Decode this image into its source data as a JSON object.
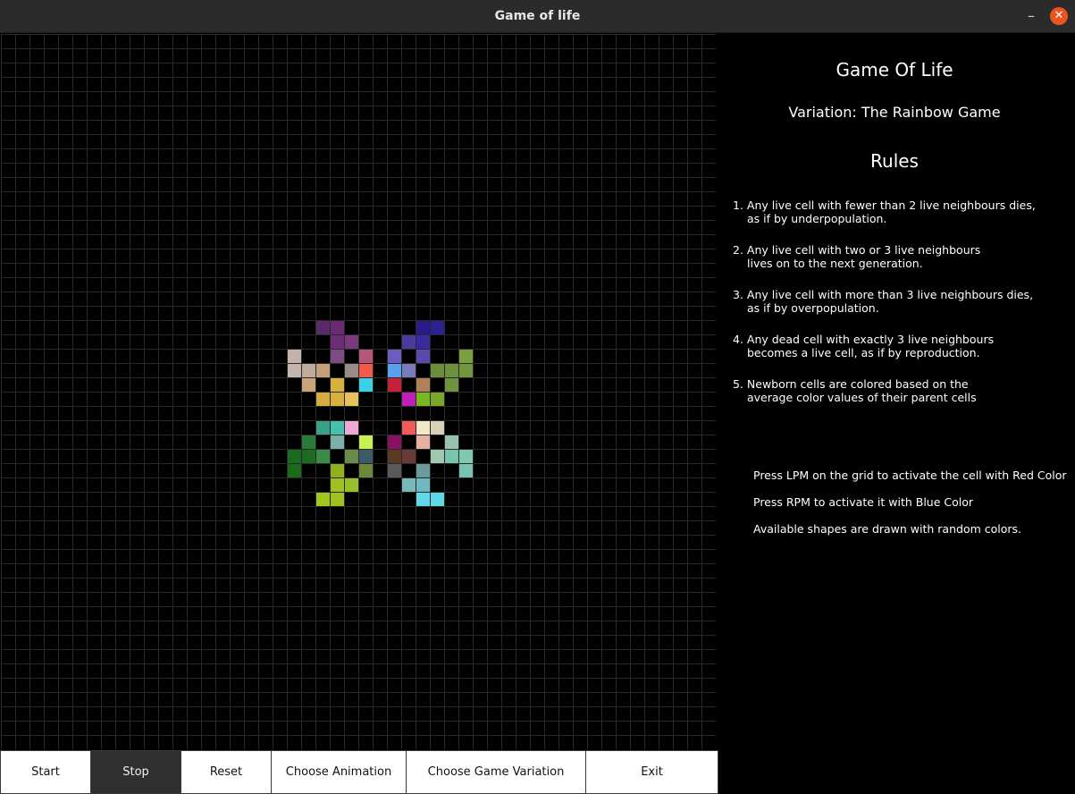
{
  "window": {
    "title": "Game of life",
    "minimize": "–",
    "close": "✕"
  },
  "panel": {
    "title": "Game Of Life",
    "variation": "Variation: The Rainbow Game",
    "rules_heading": "Rules",
    "rules": [
      {
        "line1": "1. Any live cell with fewer than 2 live neighbours dies,",
        "line2": "as if by underpopulation."
      },
      {
        "line1": "2. Any live cell with two or 3 live neighbours",
        "line2": "lives on to the next generation."
      },
      {
        "line1": "3. Any live cell with more than 3 live neighbours dies,",
        "line2": "as if by overpopulation."
      },
      {
        "line1": "4. Any dead cell with exactly 3 live neighbours",
        "line2": "becomes a live cell, as if by reproduction."
      },
      {
        "line1": "5. Newborn cells are colored based on the",
        "line2": "average color values of their parent cells"
      }
    ],
    "hints": [
      "Press LPM on the grid to activate the cell with Red Color",
      "Press RPM to activate it with Blue Color",
      "Available shapes are drawn with random colors."
    ]
  },
  "buttons": {
    "start": "Start",
    "stop": "Stop",
    "reset": "Reset",
    "choose_animation": "Choose Animation",
    "choose_variation": "Choose Game Variation",
    "exit": "Exit"
  },
  "grid": {
    "columns": 50,
    "rows": 50,
    "grid_color": "#2a2a2a",
    "live_cells": [
      {
        "c": 22,
        "r": 20,
        "color": "#5b2a6a"
      },
      {
        "c": 23,
        "r": 20,
        "color": "#6a2a72"
      },
      {
        "c": 29,
        "r": 20,
        "color": "#2a1a8c"
      },
      {
        "c": 30,
        "r": 20,
        "color": "#2e2290"
      },
      {
        "c": 23,
        "r": 21,
        "color": "#6b2d7a"
      },
      {
        "c": 24,
        "r": 21,
        "color": "#7a3a7e"
      },
      {
        "c": 28,
        "r": 21,
        "color": "#4a3a9a"
      },
      {
        "c": 29,
        "r": 21,
        "color": "#3a2aa0"
      },
      {
        "c": 20,
        "r": 22,
        "color": "#c6b2ac"
      },
      {
        "c": 23,
        "r": 22,
        "color": "#7e4b86"
      },
      {
        "c": 25,
        "r": 22,
        "color": "#b3587a"
      },
      {
        "c": 27,
        "r": 22,
        "color": "#6b5cc0"
      },
      {
        "c": 29,
        "r": 22,
        "color": "#5a4ab0"
      },
      {
        "c": 32,
        "r": 22,
        "color": "#78a042"
      },
      {
        "c": 20,
        "r": 23,
        "color": "#c4b4ae"
      },
      {
        "c": 21,
        "r": 23,
        "color": "#c0ac9c"
      },
      {
        "c": 22,
        "r": 23,
        "color": "#c4a07a"
      },
      {
        "c": 24,
        "r": 23,
        "color": "#9a8a8a"
      },
      {
        "c": 25,
        "r": 23,
        "color": "#f25a4a"
      },
      {
        "c": 27,
        "r": 23,
        "color": "#5aa0f0"
      },
      {
        "c": 28,
        "r": 23,
        "color": "#7a7ab8"
      },
      {
        "c": 30,
        "r": 23,
        "color": "#6c8e3a"
      },
      {
        "c": 31,
        "r": 23,
        "color": "#6e9040"
      },
      {
        "c": 32,
        "r": 23,
        "color": "#72963e"
      },
      {
        "c": 21,
        "r": 24,
        "color": "#c8a47a"
      },
      {
        "c": 23,
        "r": 24,
        "color": "#d8b040"
      },
      {
        "c": 25,
        "r": 24,
        "color": "#3ad0e8"
      },
      {
        "c": 27,
        "r": 24,
        "color": "#c8203a"
      },
      {
        "c": 29,
        "r": 24,
        "color": "#b08058"
      },
      {
        "c": 31,
        "r": 24,
        "color": "#6e923e"
      },
      {
        "c": 22,
        "r": 25,
        "color": "#d4ac40"
      },
      {
        "c": 23,
        "r": 25,
        "color": "#d8b040"
      },
      {
        "c": 24,
        "r": 25,
        "color": "#e8c060"
      },
      {
        "c": 28,
        "r": 25,
        "color": "#c020b8"
      },
      {
        "c": 29,
        "r": 25,
        "color": "#7ab820"
      },
      {
        "c": 30,
        "r": 25,
        "color": "#7aa62a"
      },
      {
        "c": 22,
        "r": 27,
        "color": "#3aa088"
      },
      {
        "c": 23,
        "r": 27,
        "color": "#48c0b0"
      },
      {
        "c": 24,
        "r": 27,
        "color": "#f0a8d8"
      },
      {
        "c": 28,
        "r": 27,
        "color": "#f05a5a"
      },
      {
        "c": 29,
        "r": 27,
        "color": "#f0e8c8"
      },
      {
        "c": 30,
        "r": 27,
        "color": "#d8d0b8"
      },
      {
        "c": 21,
        "r": 28,
        "color": "#2a7a3a"
      },
      {
        "c": 23,
        "r": 28,
        "color": "#7ab0a8"
      },
      {
        "c": 25,
        "r": 28,
        "color": "#c8f050"
      },
      {
        "c": 27,
        "r": 28,
        "color": "#8a1060"
      },
      {
        "c": 29,
        "r": 28,
        "color": "#e8b0a0"
      },
      {
        "c": 31,
        "r": 28,
        "color": "#9ac0b0"
      },
      {
        "c": 20,
        "r": 29,
        "color": "#1a6a20"
      },
      {
        "c": 21,
        "r": 29,
        "color": "#1e6a24"
      },
      {
        "c": 22,
        "r": 29,
        "color": "#3a8a4a"
      },
      {
        "c": 24,
        "r": 29,
        "color": "#6a8a4a"
      },
      {
        "c": 25,
        "r": 29,
        "color": "#3a5a6a"
      },
      {
        "c": 27,
        "r": 29,
        "color": "#5a3a20"
      },
      {
        "c": 28,
        "r": 29,
        "color": "#6a3a3a"
      },
      {
        "c": 30,
        "r": 29,
        "color": "#a0c8b0"
      },
      {
        "c": 31,
        "r": 29,
        "color": "#78c4b0"
      },
      {
        "c": 32,
        "r": 29,
        "color": "#80c8b0"
      },
      {
        "c": 20,
        "r": 30,
        "color": "#1a6a1a"
      },
      {
        "c": 23,
        "r": 30,
        "color": "#90b020"
      },
      {
        "c": 25,
        "r": 30,
        "color": "#6a8a3a"
      },
      {
        "c": 27,
        "r": 30,
        "color": "#5a5a5a"
      },
      {
        "c": 29,
        "r": 30,
        "color": "#6a9a9a"
      },
      {
        "c": 32,
        "r": 30,
        "color": "#78c4b0"
      },
      {
        "c": 23,
        "r": 31,
        "color": "#a0c020"
      },
      {
        "c": 24,
        "r": 31,
        "color": "#98c028"
      },
      {
        "c": 28,
        "r": 31,
        "color": "#78b8b8"
      },
      {
        "c": 29,
        "r": 31,
        "color": "#70b8c0"
      },
      {
        "c": 22,
        "r": 32,
        "color": "#a0c820"
      },
      {
        "c": 23,
        "r": 32,
        "color": "#a0c020"
      },
      {
        "c": 29,
        "r": 32,
        "color": "#60d8e8"
      },
      {
        "c": 30,
        "r": 32,
        "color": "#60d8e8"
      }
    ]
  }
}
